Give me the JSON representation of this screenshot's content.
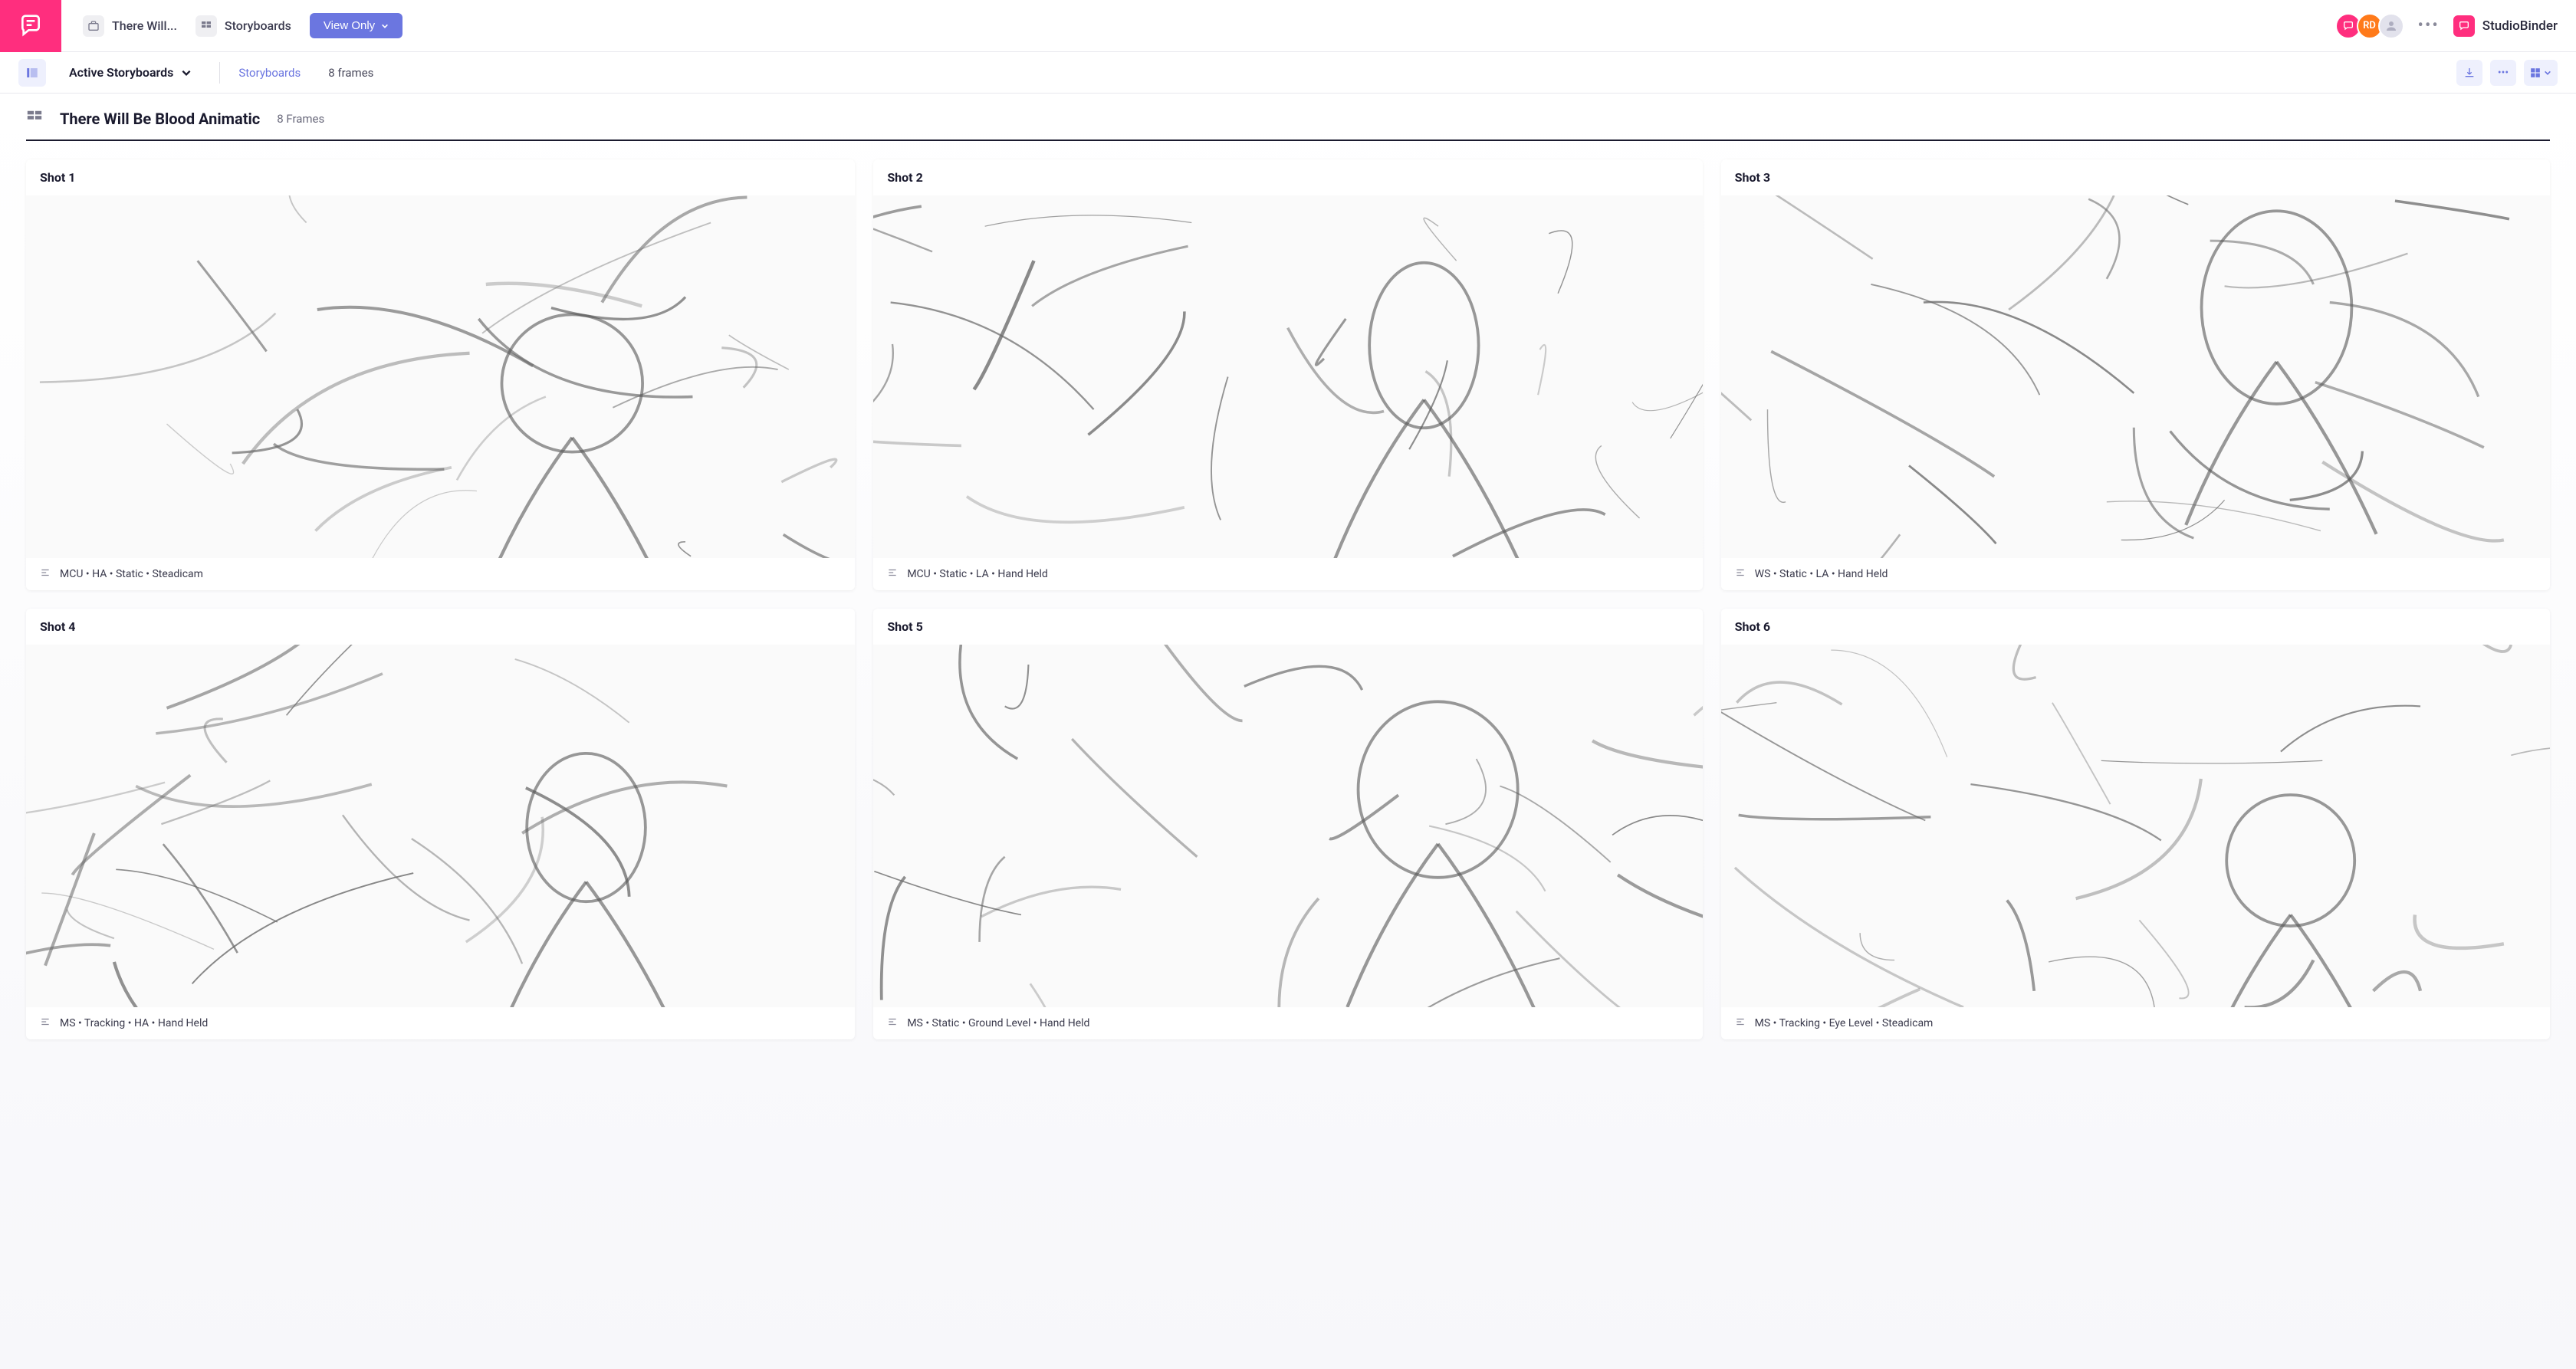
{
  "topbar": {
    "project_name": "There Will...",
    "section": "Storyboards",
    "view_mode": "View Only",
    "brand": "StudioBinder",
    "avatars": [
      {
        "label": "",
        "bg": "#ff2e7e",
        "icon": true
      },
      {
        "label": "RD",
        "bg": "#ff7a1a"
      },
      {
        "label": "",
        "bg": "#d8d8e4",
        "placeholder": true
      }
    ]
  },
  "subbar": {
    "dropdown_label": "Active Storyboards",
    "crumb": "Storyboards",
    "frames": "8 frames"
  },
  "page": {
    "title": "There Will Be Blood Animatic",
    "subtitle": "8 Frames"
  },
  "shots": [
    {
      "label": "Shot  1",
      "meta": "MCU • HA • Static • Steadicam"
    },
    {
      "label": "Shot  2",
      "meta": "MCU • Static • LA • Hand Held"
    },
    {
      "label": "Shot  3",
      "meta": "WS • Static • LA • Hand Held"
    },
    {
      "label": "Shot  4",
      "meta": "MS • Tracking • HA • Hand Held"
    },
    {
      "label": "Shot  5",
      "meta": "MS • Static • Ground Level • Hand Held"
    },
    {
      "label": "Shot  6",
      "meta": "MS • Tracking • Eye Level • Steadicam"
    }
  ]
}
